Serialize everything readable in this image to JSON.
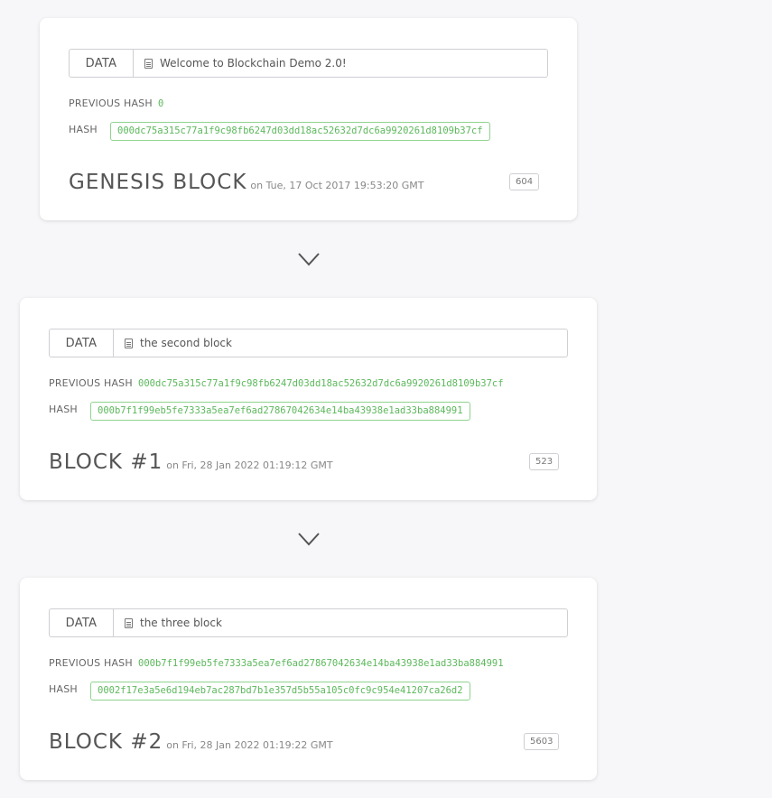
{
  "blocks": [
    {
      "data_label": "DATA",
      "data_value": "Welcome to Blockchain Demo 2.0!",
      "previous_hash_label": "PREVIOUS HASH",
      "previous_hash": "0",
      "hash_label": "HASH",
      "hash": "000dc75a315c77a1f9c98fb6247d03dd18ac52632d7dc6a9920261d8109b37cf",
      "title": "GENESIS BLOCK",
      "date": "on Tue, 17 Oct 2017 19:53:20 GMT",
      "nonce": "604"
    },
    {
      "data_label": "DATA",
      "data_value": "the second block",
      "previous_hash_label": "PREVIOUS HASH",
      "previous_hash": "000dc75a315c77a1f9c98fb6247d03dd18ac52632d7dc6a9920261d8109b37cf",
      "hash_label": "HASH",
      "hash": "000b7f1f99eb5fe7333a5ea7ef6ad27867042634e14ba43938e1ad33ba884991",
      "title": "BLOCK #1",
      "date": "on Fri, 28 Jan 2022 01:19:12 GMT",
      "nonce": "523"
    },
    {
      "data_label": "DATA",
      "data_value": "the three block",
      "previous_hash_label": "PREVIOUS HASH",
      "previous_hash": "000b7f1f99eb5fe7333a5ea7ef6ad27867042634e14ba43938e1ad33ba884991",
      "hash_label": "HASH",
      "hash": "0002f17e3a5e6d194eb7ac287bd7b1e357d5b55a105c0fc9c954e41207ca26d2",
      "title": "BLOCK #2",
      "date": "on Fri, 28 Jan 2022 01:19:22 GMT",
      "nonce": "5603"
    }
  ],
  "icons": {
    "data_icon": "document-icon",
    "connector_icon": "chevron-down-icon"
  },
  "colors": {
    "hash_green": "#5cb85c",
    "background": "#f7f7f9"
  }
}
